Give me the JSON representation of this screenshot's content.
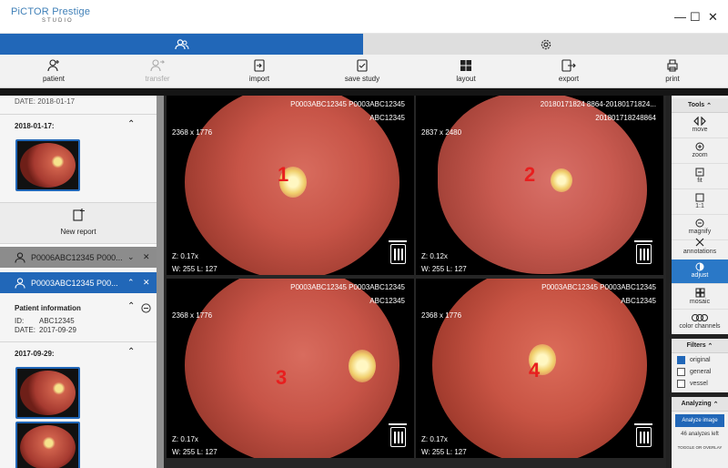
{
  "app": {
    "logo": "PiCTOR Prestige",
    "logo_sub": "STUDIO"
  },
  "window_controls": {
    "minimize": "—",
    "maximize": "☐",
    "close": "✕"
  },
  "tabs": [
    {
      "label": "",
      "icon": "patients-icon"
    },
    {
      "label": "",
      "icon": "gear-icon"
    }
  ],
  "toolbar": {
    "patient": "patient",
    "transfer": "transfer",
    "import": "import",
    "save_study": "save study",
    "layout": "layout",
    "export": "export",
    "print": "print"
  },
  "sidebar": {
    "top_date_line": "DATE:   2018-01-17",
    "study1_date": "2018-01-17:",
    "new_report": "New report",
    "patient1": "P0006ABC12345 P000...",
    "patient2": "P0003ABC12345 P00...",
    "patient_info_title": "Patient information",
    "id_label": "ID:",
    "id_value": "ABC12345",
    "date_label": "DATE:",
    "date_value": "2017-09-29",
    "study2_date": "2017-09-29:"
  },
  "viewports": [
    {
      "title1": "P0003ABC12345 P0003ABC12345",
      "title2": "ABC12345",
      "size": "2368 x 1776",
      "zoom": "Z: 0.17x",
      "wl": "W: 255  L: 127",
      "number": "1"
    },
    {
      "title1": "20180171824 8864-20180171824...",
      "title2": "201801718248864",
      "size": "2837 x 2480",
      "zoom": "Z: 0.12x",
      "wl": "W: 255  L: 127",
      "number": "2"
    },
    {
      "title1": "P0003ABC12345 P0003ABC12345",
      "title2": "ABC12345",
      "size": "2368 x 1776",
      "zoom": "Z: 0.17x",
      "wl": "W: 255  L: 127",
      "number": "3"
    },
    {
      "title1": "P0003ABC12345 P0003ABC12345",
      "title2": "ABC12345",
      "size": "2368 x 1776",
      "zoom": "Z: 0.17x",
      "wl": "W: 255  L: 127",
      "number": "4"
    }
  ],
  "tools": {
    "header": "Tools",
    "move": "move",
    "zoom": "zoom",
    "fit": "fit",
    "one_to_one": "1:1",
    "magnify": "magnify",
    "annotations": "annotations",
    "adjust": "adjust",
    "mosaic": "mosaic",
    "color_channels": "color channels"
  },
  "filters": {
    "header": "Filters",
    "original": "original",
    "general": "general",
    "vessel": "vessel"
  },
  "analyzing": {
    "header": "Analyzing",
    "button": "Analyze image",
    "left": "46 analyzes left",
    "toggle": "TOGGLE OR OVERLAY"
  },
  "colors": {
    "accent": "#2167b8",
    "active_tool": "#2a78c7",
    "label_red": "#e81e1e"
  }
}
